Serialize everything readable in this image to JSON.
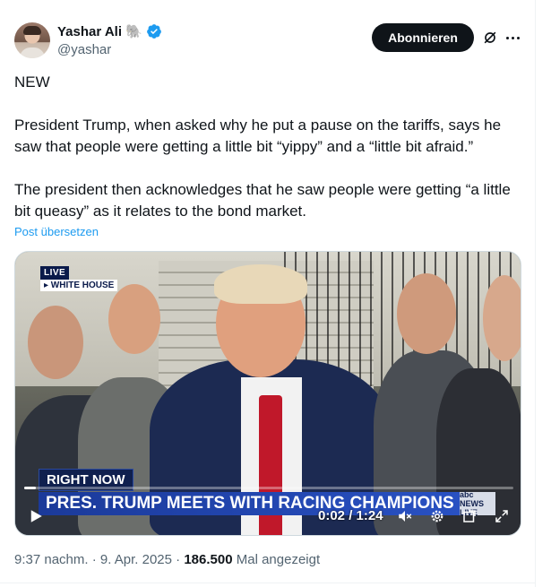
{
  "author": {
    "display_name": "Yashar Ali",
    "emoji": "🐘",
    "handle": "@yashar"
  },
  "actions": {
    "follow_label": "Abonnieren"
  },
  "tweet": {
    "paragraphs": [
      "NEW",
      "President Trump, when asked why he put a pause on the tariffs, says he saw that people were getting a little bit “yippy” and a “little bit afraid.”",
      "The president then acknowledges that he saw people were getting “a little bit queasy” as it relates to the bond market."
    ],
    "translate_label": "Post übersetzen"
  },
  "video": {
    "live_label": "LIVE",
    "location_label": "▸ WHITE HOUSE",
    "right_now_label": "RIGHT NOW",
    "headline": "PRES. TRUMP MEETS WITH RACING CHAMPIONS",
    "network_logo": "abc NEWS LIVE",
    "time_display": "0:02 / 1:24",
    "progress": 0.024
  },
  "meta": {
    "time": "9:37 nachm.",
    "separator": "·",
    "date": "9. Apr. 2025",
    "views": "186.500",
    "views_label": "Mal angezeigt"
  },
  "colors": {
    "accent": "#1d9bf0",
    "text": "#0f1419",
    "secondary": "#536471",
    "verified": "#1d9bf0"
  }
}
